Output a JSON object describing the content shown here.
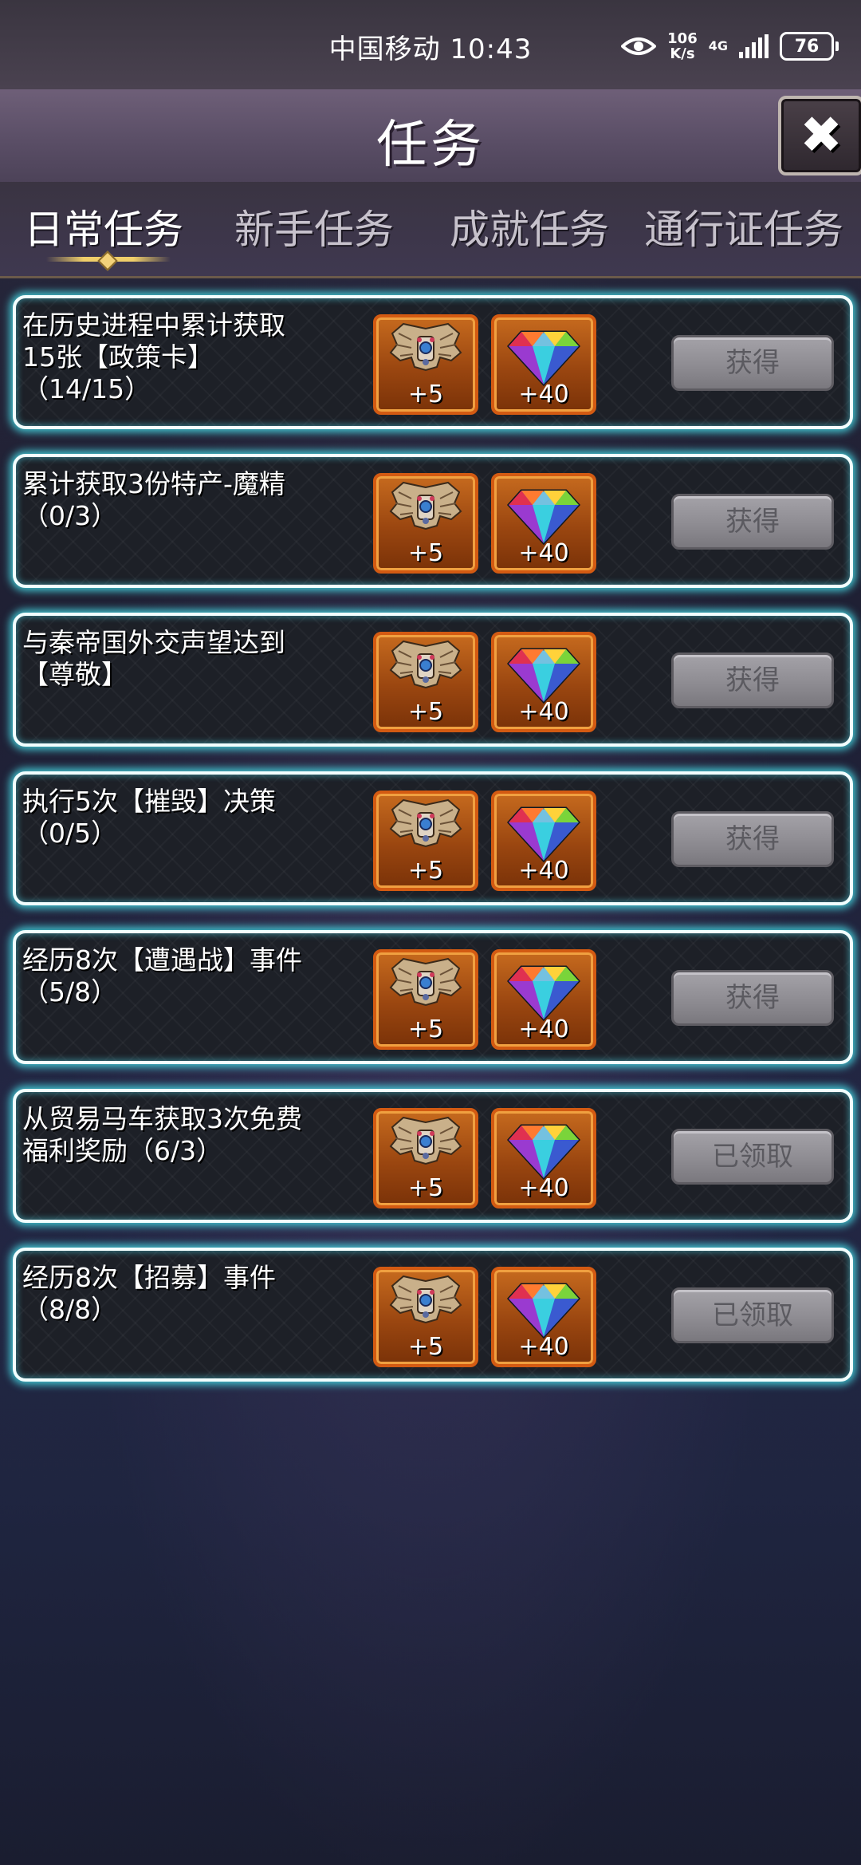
{
  "status_bar": {
    "carrier_time": "中国移动 10:43",
    "net_speed_value": "106",
    "net_speed_unit": "K/s",
    "network": "4G",
    "battery": "76"
  },
  "header": {
    "title": "任务",
    "close_label": "✖"
  },
  "tabs": [
    {
      "label": "日常任务",
      "active": true
    },
    {
      "label": "新手任务",
      "active": false
    },
    {
      "label": "成就任务",
      "active": false
    },
    {
      "label": "通行证任务",
      "active": false
    }
  ],
  "tasks": [
    {
      "line1": "在历史进程中累计获取",
      "line2": "15张【政策卡】",
      "progress": "（14/15）",
      "reward1": "+5",
      "reward2": "+40",
      "action": "获得"
    },
    {
      "line1": "累计获取3份特产-魔精",
      "line2": "",
      "progress": "（0/3）",
      "reward1": "+5",
      "reward2": "+40",
      "action": "获得"
    },
    {
      "line1": "与秦帝国外交声望达到",
      "line2": "【尊敬】",
      "progress": "",
      "reward1": "+5",
      "reward2": "+40",
      "action": "获得"
    },
    {
      "line1": "执行5次【摧毁】决策",
      "line2": "",
      "progress": "（0/5）",
      "reward1": "+5",
      "reward2": "+40",
      "action": "获得"
    },
    {
      "line1": "经历8次【遭遇战】事件",
      "line2": "",
      "progress": "（5/8）",
      "reward1": "+5",
      "reward2": "+40",
      "action": "获得"
    },
    {
      "line1": "从贸易马车获取3次免费",
      "line2": "福利奖励（6/3）",
      "progress": "",
      "reward1": "+5",
      "reward2": "+40",
      "action": "已领取"
    },
    {
      "line1": "经历8次【招募】事件",
      "line2": "",
      "progress": "（8/8）",
      "reward1": "+5",
      "reward2": "+40",
      "action": "已领取"
    }
  ],
  "colors": {
    "card_glow": "#46dce6",
    "reward_frame": "#d35a12",
    "button_gray": "#8c8a90",
    "tab_underline": "#f0cf6a"
  },
  "icons": {
    "reward1": "winged-emblem-icon",
    "reward2": "rainbow-gem-icon"
  }
}
